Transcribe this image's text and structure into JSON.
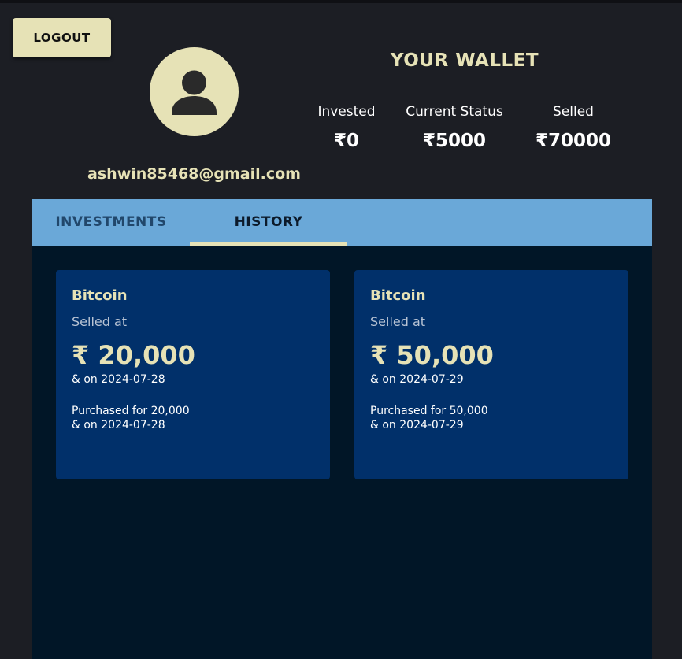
{
  "header": {
    "logout_label": "LOGOUT"
  },
  "profile": {
    "avatar_icon": "user-icon",
    "email": "ashwin85468@gmail.com"
  },
  "wallet": {
    "title": "YOUR WALLET",
    "stats": [
      {
        "label": "Invested",
        "value": "₹0"
      },
      {
        "label": "Current Status",
        "value": "₹5000"
      },
      {
        "label": "Selled",
        "value": "₹70000"
      }
    ]
  },
  "tabs": [
    {
      "label": "INVESTMENTS",
      "active": false
    },
    {
      "label": "HISTORY",
      "active": true
    }
  ],
  "history": [
    {
      "coin": "Bitcoin",
      "sold_label": "Selled at",
      "price": "₹ 20,000",
      "sold_date": "& on 2024-07-28",
      "purchase": "Purchased for 20,000",
      "purchase_date": "& on 2024-07-28"
    },
    {
      "coin": "Bitcoin",
      "sold_label": "Selled at",
      "price": "₹ 50,000",
      "sold_date": "& on 2024-07-29",
      "purchase": "Purchased for 50,000",
      "purchase_date": "& on 2024-07-29"
    }
  ],
  "colors": {
    "accent": "#e6e2b6",
    "background": "#1c1e24",
    "tab_bar": "#6aa8d8",
    "panel": "#011627",
    "card": "#01306a"
  }
}
